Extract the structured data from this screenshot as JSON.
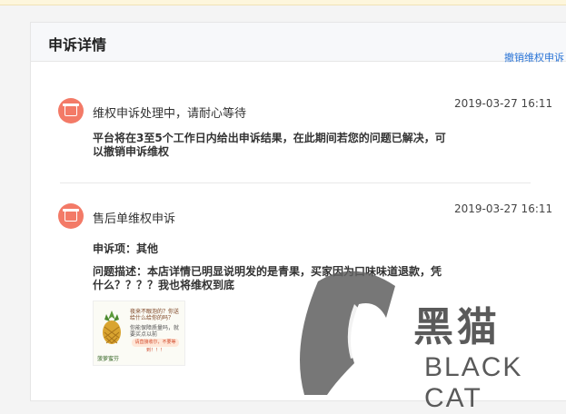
{
  "card": {
    "title": "申诉详情",
    "revoke_label": "撤销维权申诉"
  },
  "entries": [
    {
      "title": "维权申诉处理中，请耐心等待",
      "time": "2019-03-27 16:11",
      "lines": [
        "平台将在3至5个工作日内给出申诉结果，在此期间若您的问题已解决，可",
        "以撤销申诉维权"
      ]
    },
    {
      "title": "售后单维权申诉",
      "time": "2019-03-27 16:11",
      "item": "申诉项：其他",
      "desc_lines": [
        "问题描述：本店详情已明显说明发的是青果，买家因为口味味道退款，凭",
        "什么？？？？我也将维权到底"
      ]
    }
  ],
  "thumbnail": {
    "banner_text": "夜来不眼泡的？你送给什么给你的吗？",
    "sub_text": "你能保障质量吗，就要买点以前",
    "pill_text": "请直接收尔，不要等到！！！",
    "corner": "菠萝蜜芬"
  },
  "watermark": {
    "cn": "黑猫",
    "en": "BLACK CAT"
  }
}
